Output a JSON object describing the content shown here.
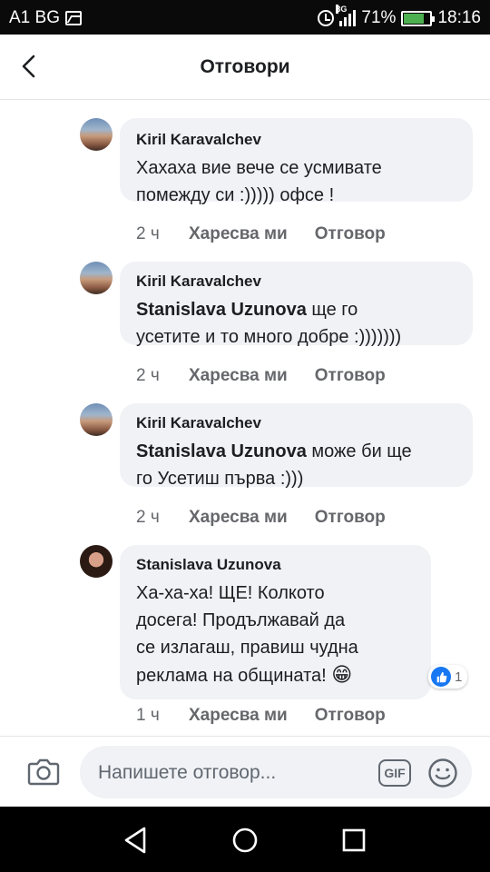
{
  "status_bar": {
    "carrier": "A1 BG",
    "network": "3G",
    "battery": "71%",
    "battery_level": 0.71,
    "time": "18:16"
  },
  "header": {
    "title": "Отговори"
  },
  "comments": [
    {
      "author": "Kiril Karavalchev",
      "mention": "",
      "text": "Хахаха вие вече се усмивате\nпомежду си :))))) офсе !",
      "time": "2 ч",
      "like": "Харесва ми",
      "reply": "Отговор"
    },
    {
      "author": "Kiril Karavalchev",
      "mention": "Stanislava Uzunova",
      "text": " ще го\nусетите и то много добре :)))))))",
      "time": "2 ч",
      "like": "Харесва ми",
      "reply": "Отговор"
    },
    {
      "author": "Kiril Karavalchev",
      "mention": "Stanislava Uzunova",
      "text": " може би ще\nго Усетиш първа :)))",
      "time": "2 ч",
      "like": "Харесва ми",
      "reply": "Отговор"
    },
    {
      "author": "Stanislava Uzunova",
      "mention": "",
      "text": "Ха-ха-ха! ЩЕ! Колкото\nдосега! Продължавай да\nсе излагаш, правиш чудна\nреклама на общината! ",
      "emoji": "😁",
      "reaction_count": "1",
      "time": "1 ч",
      "like": "Харесва ми",
      "reply": "Отговор"
    }
  ],
  "composer": {
    "placeholder": "Напишете отговор...",
    "gif_label": "GIF"
  },
  "colors": {
    "bubble": "#f0f2f5",
    "like_blue": "#1877f2",
    "meta_text": "#65676b"
  }
}
